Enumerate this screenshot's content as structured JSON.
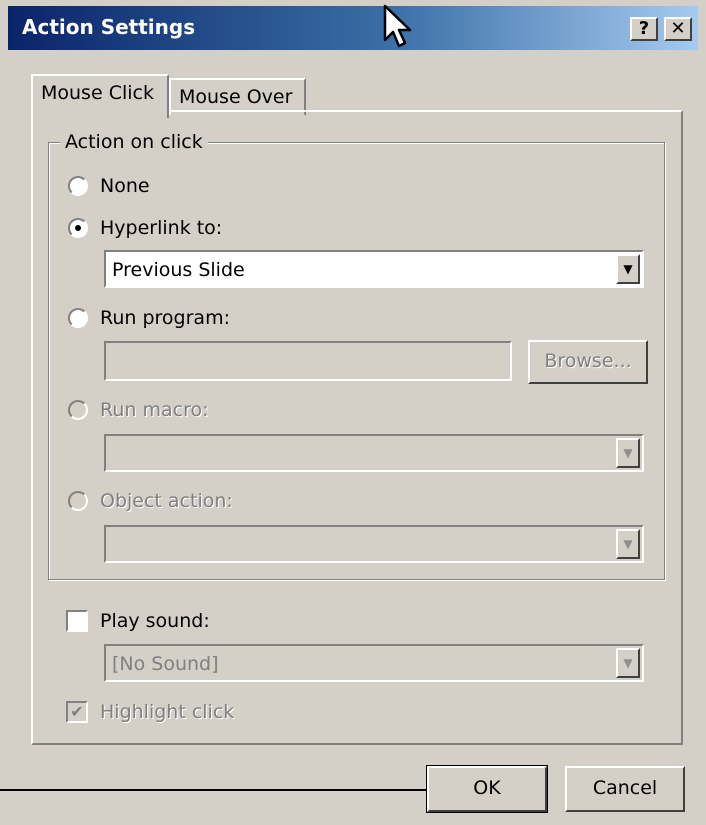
{
  "window": {
    "title": "Action Settings",
    "help_glyph": "?",
    "close_glyph": "✕"
  },
  "tabs": [
    {
      "label": "Mouse Click",
      "active": true
    },
    {
      "label": "Mouse Over",
      "active": false
    }
  ],
  "action_group": {
    "legend": "Action on click",
    "options": {
      "none": {
        "label": "None",
        "selected": false,
        "enabled": true
      },
      "hyperlink": {
        "label": "Hyperlink to:",
        "selected": true,
        "enabled": true
      },
      "run_program": {
        "label": "Run program:",
        "selected": false,
        "enabled": true
      },
      "run_macro": {
        "label": "Run macro:",
        "selected": false,
        "enabled": false
      },
      "object_action": {
        "label": "Object action:",
        "selected": false,
        "enabled": false
      }
    },
    "hyperlink_select": {
      "value": "Previous Slide"
    },
    "run_program_input": {
      "value": ""
    },
    "browse_label": "Browse...",
    "run_macro_select": {
      "value": ""
    },
    "object_action_select": {
      "value": ""
    }
  },
  "sound": {
    "play_sound_label": "Play sound:",
    "play_sound_checked": false,
    "sound_select": {
      "value": "[No Sound]"
    }
  },
  "highlight": {
    "label": "Highlight click",
    "checked": true,
    "enabled": false
  },
  "buttons": {
    "ok": "OK",
    "cancel": "Cancel"
  },
  "icons": {
    "dropdown": "▼",
    "check": "✔"
  },
  "colors": {
    "titlebar_start": "#0a246a",
    "titlebar_end": "#a6caf0",
    "face": "#d4d0c8"
  }
}
